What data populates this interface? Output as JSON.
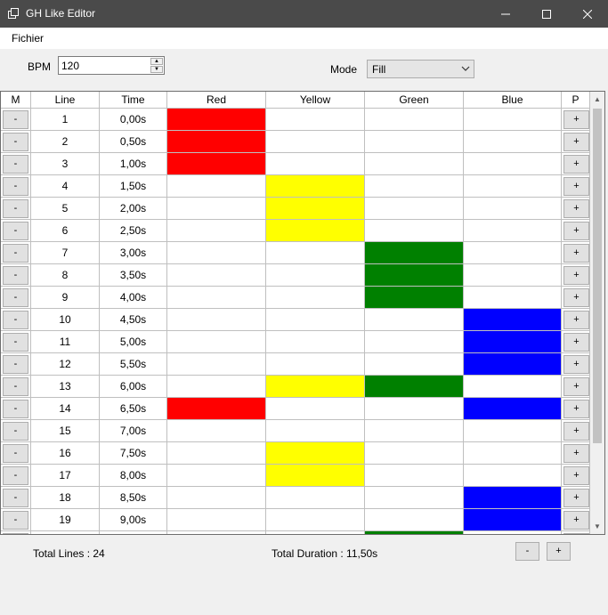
{
  "window": {
    "title": "GH Like Editor",
    "minimize_icon": "minimize-icon",
    "maximize_icon": "maximize-icon",
    "close_icon": "close-icon"
  },
  "menu": {
    "items": [
      "Fichier"
    ]
  },
  "controls": {
    "bpm_label": "BPM",
    "bpm_value": "120",
    "mode_label": "Mode",
    "mode_value": "Fill"
  },
  "grid": {
    "columns": [
      "M",
      "Line",
      "Time",
      "Red",
      "Yellow",
      "Green",
      "Blue",
      "P"
    ],
    "remove_label": "-",
    "add_label": "+",
    "colors": {
      "red": "#ff0000",
      "yellow": "#ffff00",
      "green": "#008000",
      "blue": "#0000ff"
    },
    "rows": [
      {
        "line": "1",
        "time": "0,00s",
        "notes": [
          "red"
        ]
      },
      {
        "line": "2",
        "time": "0,50s",
        "notes": [
          "red"
        ]
      },
      {
        "line": "3",
        "time": "1,00s",
        "notes": [
          "red"
        ]
      },
      {
        "line": "4",
        "time": "1,50s",
        "notes": [
          "yellow"
        ]
      },
      {
        "line": "5",
        "time": "2,00s",
        "notes": [
          "yellow"
        ]
      },
      {
        "line": "6",
        "time": "2,50s",
        "notes": [
          "yellow"
        ]
      },
      {
        "line": "7",
        "time": "3,00s",
        "notes": [
          "green"
        ]
      },
      {
        "line": "8",
        "time": "3,50s",
        "notes": [
          "green"
        ]
      },
      {
        "line": "9",
        "time": "4,00s",
        "notes": [
          "green"
        ]
      },
      {
        "line": "10",
        "time": "4,50s",
        "notes": [
          "blue"
        ]
      },
      {
        "line": "11",
        "time": "5,00s",
        "notes": [
          "blue"
        ]
      },
      {
        "line": "12",
        "time": "5,50s",
        "notes": [
          "blue"
        ]
      },
      {
        "line": "13",
        "time": "6,00s",
        "notes": [
          "yellow",
          "green"
        ]
      },
      {
        "line": "14",
        "time": "6,50s",
        "notes": [
          "red",
          "blue"
        ]
      },
      {
        "line": "15",
        "time": "7,00s",
        "notes": []
      },
      {
        "line": "16",
        "time": "7,50s",
        "notes": [
          "yellow"
        ]
      },
      {
        "line": "17",
        "time": "8,00s",
        "notes": [
          "yellow"
        ]
      },
      {
        "line": "18",
        "time": "8,50s",
        "notes": [
          "blue"
        ]
      },
      {
        "line": "19",
        "time": "9,00s",
        "notes": [
          "blue"
        ]
      },
      {
        "line": "",
        "time": "",
        "notes": [
          "green"
        ]
      }
    ]
  },
  "footer": {
    "total_lines": "Total Lines : 24",
    "total_duration": "Total Duration : 11,50s",
    "remove_label": "-",
    "add_label": "+"
  }
}
